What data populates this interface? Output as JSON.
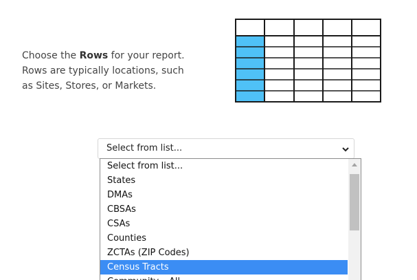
{
  "instructions": {
    "prefix": "Choose the ",
    "bold": "Rows",
    "suffix": " for your report. Rows are typically locations, such as Sites, Stores, or Markets."
  },
  "illustration": {
    "icon": "table-rows-icon",
    "highlight_color": "#4fc1f7",
    "border_color": "#1a1a1a"
  },
  "select": {
    "value": "Select from list...",
    "options": [
      "Select from list...",
      "States",
      "DMAs",
      "CBSAs",
      "CSAs",
      "Counties",
      "ZCTAs (ZIP Codes)",
      "Census Tracts",
      "Community – All"
    ],
    "highlighted_option": "Census Tracts",
    "highlight_color": "#3b8df4"
  }
}
